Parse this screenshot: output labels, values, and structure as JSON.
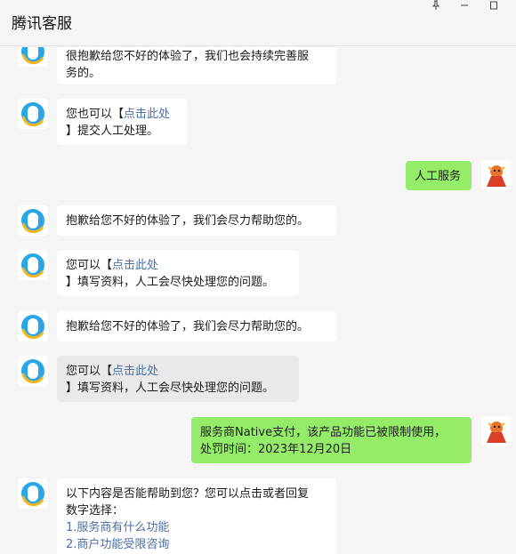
{
  "window": {
    "title": "腾讯客服",
    "pin_icon": "pin-icon",
    "minimize_icon": "minimize-icon",
    "maximize_icon": "maximize-icon"
  },
  "messages": [
    {
      "side": "left",
      "lines": [
        "很抱歉给您不好的体验了，我们也会持续完善服",
        "务的。"
      ]
    },
    {
      "side": "left",
      "line1_prefix": "您也可以【",
      "line1_link": "点击此处",
      "line2": "】提交人工处理。"
    },
    {
      "side": "right",
      "text": "人工服务"
    },
    {
      "side": "left",
      "text": "抱歉给您不好的体验了，我们会尽力帮助您的。"
    },
    {
      "side": "left",
      "line1_prefix": "您可以【",
      "line1_link": "点击此处",
      "line2": "】填写资料，人工会尽快处理您的问题。"
    },
    {
      "side": "left",
      "text": "抱歉给您不好的体验了，我们会尽力帮助您的。"
    },
    {
      "side": "left",
      "line1_prefix": "您可以【",
      "line1_link": "点击此处",
      "line2": "】填写资料，人工会尽快处理您的问题。"
    },
    {
      "side": "right",
      "lines": [
        "服务商Native支付，该产品功能已被限制使用，",
        "处罚时间：2023年12月20日"
      ]
    },
    {
      "side": "left",
      "lines": [
        "以下内容是否能帮助到您？您可以点击或者回复",
        "数字选择："
      ],
      "options": [
        "1.服务商有什么功能",
        "2.商户功能受限咨询"
      ]
    }
  ],
  "colors": {
    "outgoing_bubble": "#95ec69",
    "incoming_bubble": "#ffffff",
    "link": "#4a6fa5",
    "background": "#f5f5f5"
  }
}
